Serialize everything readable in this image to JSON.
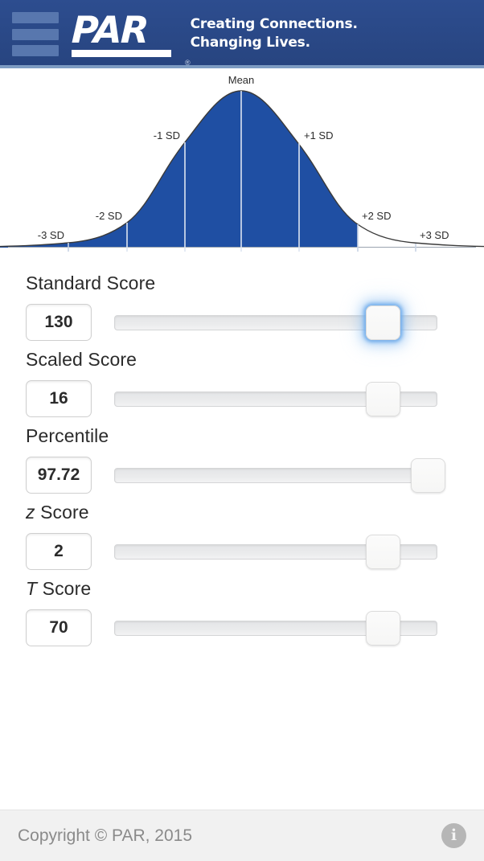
{
  "header": {
    "logo_text": "PAR",
    "registered_mark": "®",
    "tagline_line1": "Creating Connections.",
    "tagline_line2": "Changing Lives.",
    "bg_color": "#2b4a89",
    "bar_color": "#5877ae"
  },
  "chart_data": {
    "type": "area",
    "title": "",
    "xlabel": "",
    "ylabel": "",
    "grid": false,
    "legend": "none",
    "fill_color": "#1f4fa3",
    "curve_color": "#333333",
    "distribution": "normal",
    "x": [
      -3,
      -2,
      -1,
      0,
      1,
      2,
      3
    ],
    "tick_labels": [
      "-3 SD",
      "-2 SD",
      "-1 SD",
      "Mean",
      "+1 SD",
      "+2 SD",
      "+3 SD"
    ],
    "y": [
      0.011,
      0.135,
      0.607,
      1.0,
      0.607,
      0.135,
      0.011
    ],
    "shaded_from": -3.4,
    "shaded_to": 2,
    "annotations": [
      {
        "label": "Mean",
        "x": 0
      },
      {
        "label": "-1 SD",
        "x": -1
      },
      {
        "label": "+1 SD",
        "x": 1
      },
      {
        "label": "-2 SD",
        "x": -2
      },
      {
        "label": "+2 SD",
        "x": 2
      },
      {
        "label": "-3 SD",
        "x": -3
      },
      {
        "label": "+3 SD",
        "x": 3
      }
    ]
  },
  "form": {
    "rows": [
      {
        "label_prefix": "",
        "label": "Standard Score",
        "value": "130",
        "slider_percent": 83,
        "focused": true
      },
      {
        "label_prefix": "",
        "label": "Scaled Score",
        "value": "16",
        "slider_percent": 83,
        "focused": false
      },
      {
        "label_prefix": "",
        "label": "Percentile",
        "value": "97.72",
        "slider_percent": 97,
        "focused": false
      },
      {
        "label_prefix": "z",
        "label": " Score",
        "value": "2",
        "slider_percent": 83,
        "focused": false
      },
      {
        "label_prefix": "T",
        "label": " Score",
        "value": "70",
        "slider_percent": 83,
        "focused": false
      }
    ]
  },
  "footer": {
    "copyright": "Copyright © PAR, 2015",
    "info_glyph": "i"
  }
}
